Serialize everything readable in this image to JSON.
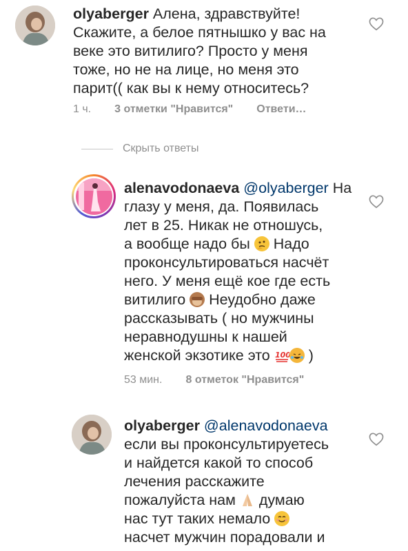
{
  "comments": [
    {
      "username": "olyaberger",
      "lines": [
        "Алена, здравствуйте!",
        "Скажите, а белое пятнышко у вас на",
        "веке это витилиго? Просто у меня",
        "тоже, но не на лице, но меня это",
        "парит(( как вы к нему относитесь?"
      ],
      "time": "1 ч.",
      "likes": "3 отметки \"Нравится\"",
      "reply": "Ответи…"
    },
    {
      "username": "alenavodonaeva",
      "mention": "@olyaberger",
      "first_tail": "На",
      "lines": [
        "глазу у меня, да. Появилась",
        "лет в 25. Никак не отношусь,",
        "а вообще надо бы",
        "Надо",
        "проконсультироваться насчёт",
        "него. У меня ещё кое где есть",
        "витилиго",
        "Неудобно даже",
        "рассказывать ( но мужчины",
        "неравнодушны к нашей",
        "женской экзотике это",
        ")"
      ],
      "time": "53 мин.",
      "likes": "8 отметок \"Нравится\""
    },
    {
      "username": "olyaberger",
      "mention": "@alenavodonaeva",
      "lines": [
        "если вы проконсультируетесь",
        "и найдется какой то способ",
        "лечения расскажите",
        "пожалуйста нам",
        "думаю",
        "нас тут таких немало",
        "насчет мужчин порадовали и"
      ]
    }
  ],
  "hide_replies": "Скрыть ответы",
  "icons": {
    "heart": "heart-outline-icon",
    "thinking": "thinking-face-emoji",
    "monkey": "see-no-evil-monkey-emoji",
    "hundred": "hundred-points-emoji",
    "laugh": "laughing-cat-emoji",
    "pray": "folded-hands-emoji",
    "smile": "smiling-face-emoji"
  },
  "colors": {
    "text": "#262626",
    "secondary": "#8e8e8e",
    "mention": "#00376b"
  }
}
